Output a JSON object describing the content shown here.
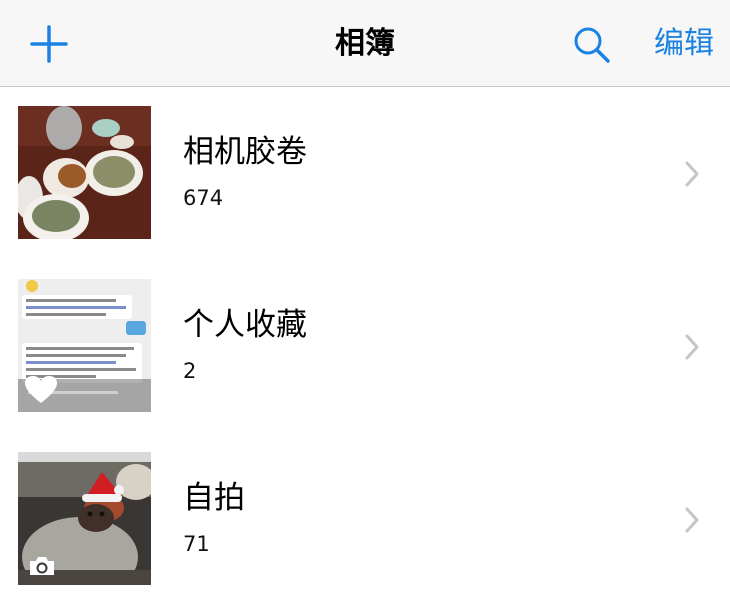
{
  "header": {
    "title": "相簿",
    "edit_label": "编辑",
    "accent_color": "#1a82e2",
    "left_icon": "plus-icon",
    "search_icon": "search-icon"
  },
  "albums": [
    {
      "name": "相机胶卷",
      "count": "674",
      "thumbnail": "food-dishes-photo"
    },
    {
      "name": "个人收藏",
      "count": "2",
      "thumbnail": "chat-screenshot-photo",
      "badge_icon": "heart-icon"
    },
    {
      "name": "自拍",
      "count": "71",
      "thumbnail": "dog-santa-hat-photo",
      "badge_icon": "selfie-camera-icon"
    }
  ]
}
